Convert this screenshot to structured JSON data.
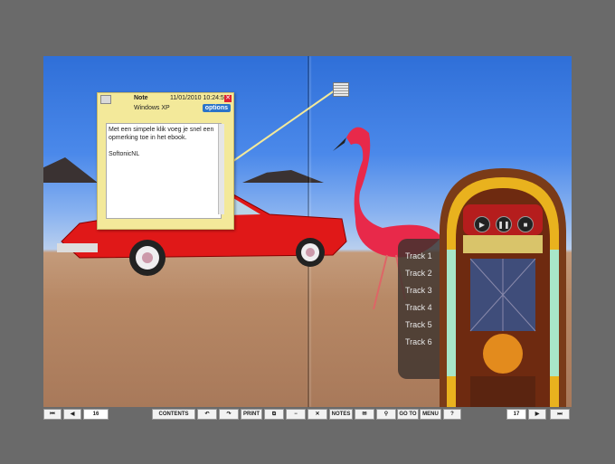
{
  "note": {
    "title": "Note",
    "date": "11/01/2010 10:24:55",
    "author": "Windows XP",
    "options_label": "options",
    "close_glyph": "✕",
    "body_line1": "Met een simpele klik voeg je snel een opmerking toe in het ebook.",
    "body_line2": "SoftonicNL"
  },
  "tracks": [
    "Track 1",
    "Track 2",
    "Track 3",
    "Track 4",
    "Track 5",
    "Track 6"
  ],
  "toolbar": {
    "first_glyph": "⏮",
    "prev_glyph": "◀",
    "left_page": "16",
    "contents": "CONTENTS",
    "undo_glyph": "↶",
    "redo_glyph": "↷",
    "print": "PRINT",
    "copy_glyph": "⧉",
    "minus_glyph": "−",
    "cross_glyph": "✕",
    "notes": "NOTES",
    "mail_glyph": "✉",
    "search_glyph": "⚲",
    "goto": "GO TO",
    "menu": "MENU",
    "help": "?",
    "right_page": "17",
    "next_glyph": "▶",
    "last_glyph": "⏭"
  },
  "colors": {
    "background": "#6a6a6a",
    "note": "#f3e99a",
    "options": "#2b74c9",
    "car": "#e01818"
  }
}
